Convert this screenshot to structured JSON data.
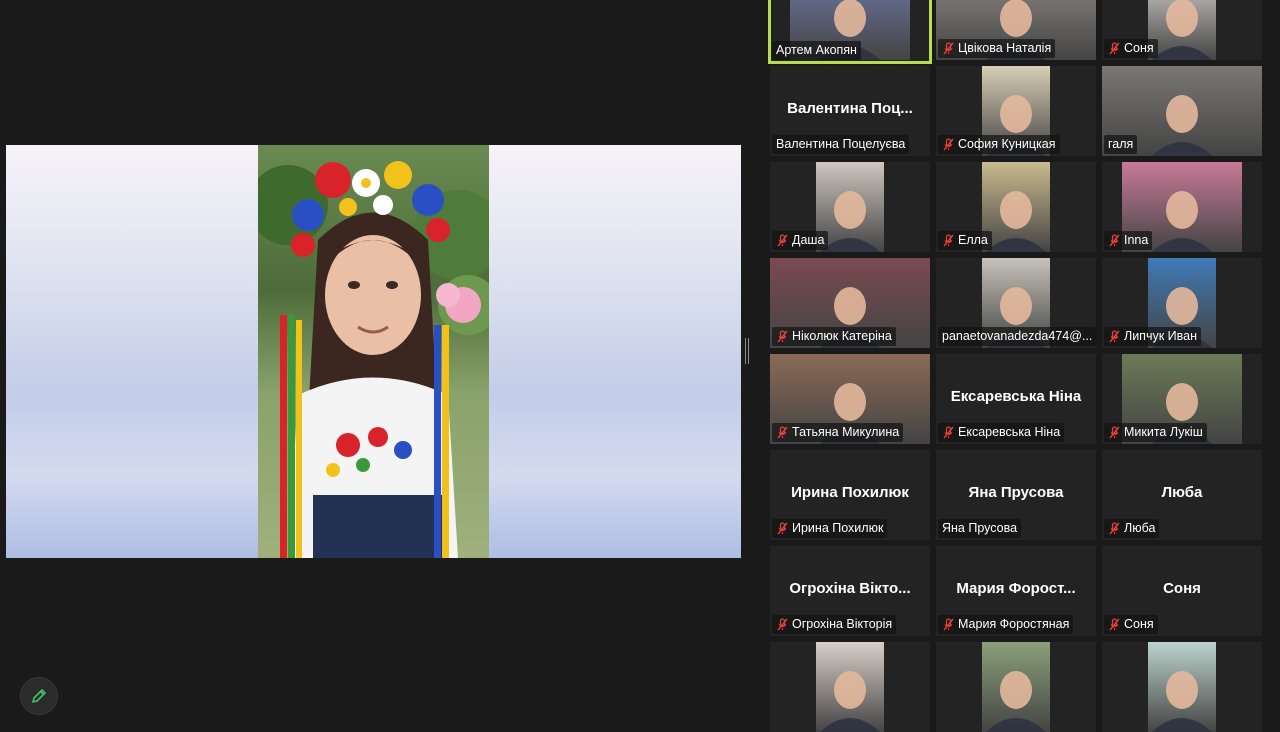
{
  "gallery": {
    "tiles": [
      {
        "label": "Артем Акопян",
        "muted": false,
        "active": true,
        "video": true,
        "title": ""
      },
      {
        "label": "Цвікова Наталія",
        "muted": true,
        "active": false,
        "video": true,
        "title": ""
      },
      {
        "label": "Соня",
        "muted": true,
        "active": false,
        "video": true,
        "title": ""
      },
      {
        "label": "Валентина Поцелуєва",
        "muted": false,
        "active": false,
        "video": false,
        "title": "Валентина  Поц..."
      },
      {
        "label": "София Куницкая",
        "muted": true,
        "active": false,
        "video": true,
        "title": ""
      },
      {
        "label": "галя",
        "muted": false,
        "active": false,
        "video": true,
        "title": ""
      },
      {
        "label": "Даша",
        "muted": true,
        "active": false,
        "video": true,
        "title": ""
      },
      {
        "label": "Елла",
        "muted": true,
        "active": false,
        "video": true,
        "title": ""
      },
      {
        "label": "Inna",
        "muted": true,
        "active": false,
        "video": true,
        "title": ""
      },
      {
        "label": "Ніколюк Катеріна",
        "muted": true,
        "active": false,
        "video": true,
        "title": ""
      },
      {
        "label": "panaetovanadezda474@...",
        "muted": false,
        "active": false,
        "video": true,
        "title": ""
      },
      {
        "label": "Липчук Иван",
        "muted": true,
        "active": false,
        "video": true,
        "title": ""
      },
      {
        "label": "Татьяна Микулина",
        "muted": true,
        "active": false,
        "video": true,
        "title": ""
      },
      {
        "label": "Ексаревська Ніна",
        "muted": true,
        "active": false,
        "video": false,
        "title": "Ексаревська Ніна"
      },
      {
        "label": "Микита Лукіш",
        "muted": true,
        "active": false,
        "video": true,
        "title": ""
      },
      {
        "label": "Ирина Похилюк",
        "muted": true,
        "active": false,
        "video": false,
        "title": "Ирина Похилюк"
      },
      {
        "label": "Яна Прусова",
        "muted": false,
        "active": false,
        "video": false,
        "title": "Яна Прусова"
      },
      {
        "label": "Люба",
        "muted": true,
        "active": false,
        "video": false,
        "title": "Люба"
      },
      {
        "label": "Огрохіна Вікторія",
        "muted": true,
        "active": false,
        "video": false,
        "title": "Огрохіна Вікто..."
      },
      {
        "label": "Мария Форостяная",
        "muted": true,
        "active": false,
        "video": false,
        "title": "Мария  Форост..."
      },
      {
        "label": "Соня",
        "muted": true,
        "active": false,
        "video": false,
        "title": "Соня"
      },
      {
        "label": "",
        "muted": true,
        "active": false,
        "video": true,
        "title": ""
      },
      {
        "label": "",
        "muted": true,
        "active": false,
        "video": true,
        "title": ""
      },
      {
        "label": "",
        "muted": true,
        "active": false,
        "video": true,
        "title": ""
      }
    ]
  },
  "colors": {
    "background": "#1a1a1a",
    "tile": "#232323",
    "active_border": "#b8dc4a",
    "muted_icon": "#e0403a",
    "annotate_icon": "#3ec46d"
  },
  "icons": {
    "muted": "mic-muted-icon",
    "annotate": "pencil-icon"
  }
}
